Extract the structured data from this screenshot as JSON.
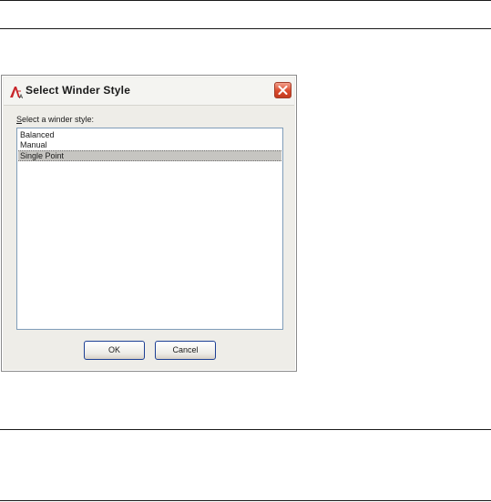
{
  "dialog": {
    "title": "Select Winder Style",
    "prompt_underlined": "S",
    "prompt_rest": "elect a winder style:",
    "items": [
      {
        "label": "Balanced",
        "selected": false
      },
      {
        "label": "Manual",
        "selected": false
      },
      {
        "label": "Single Point",
        "selected": true
      }
    ],
    "ok_label": "OK",
    "cancel_label": "Cancel"
  },
  "icons": {
    "app": "autocad-a-icon",
    "close": "close-icon"
  },
  "colors": {
    "close_button": "#d94a2c",
    "selection": "#c6c5c1",
    "list_border": "#7f9db9"
  }
}
